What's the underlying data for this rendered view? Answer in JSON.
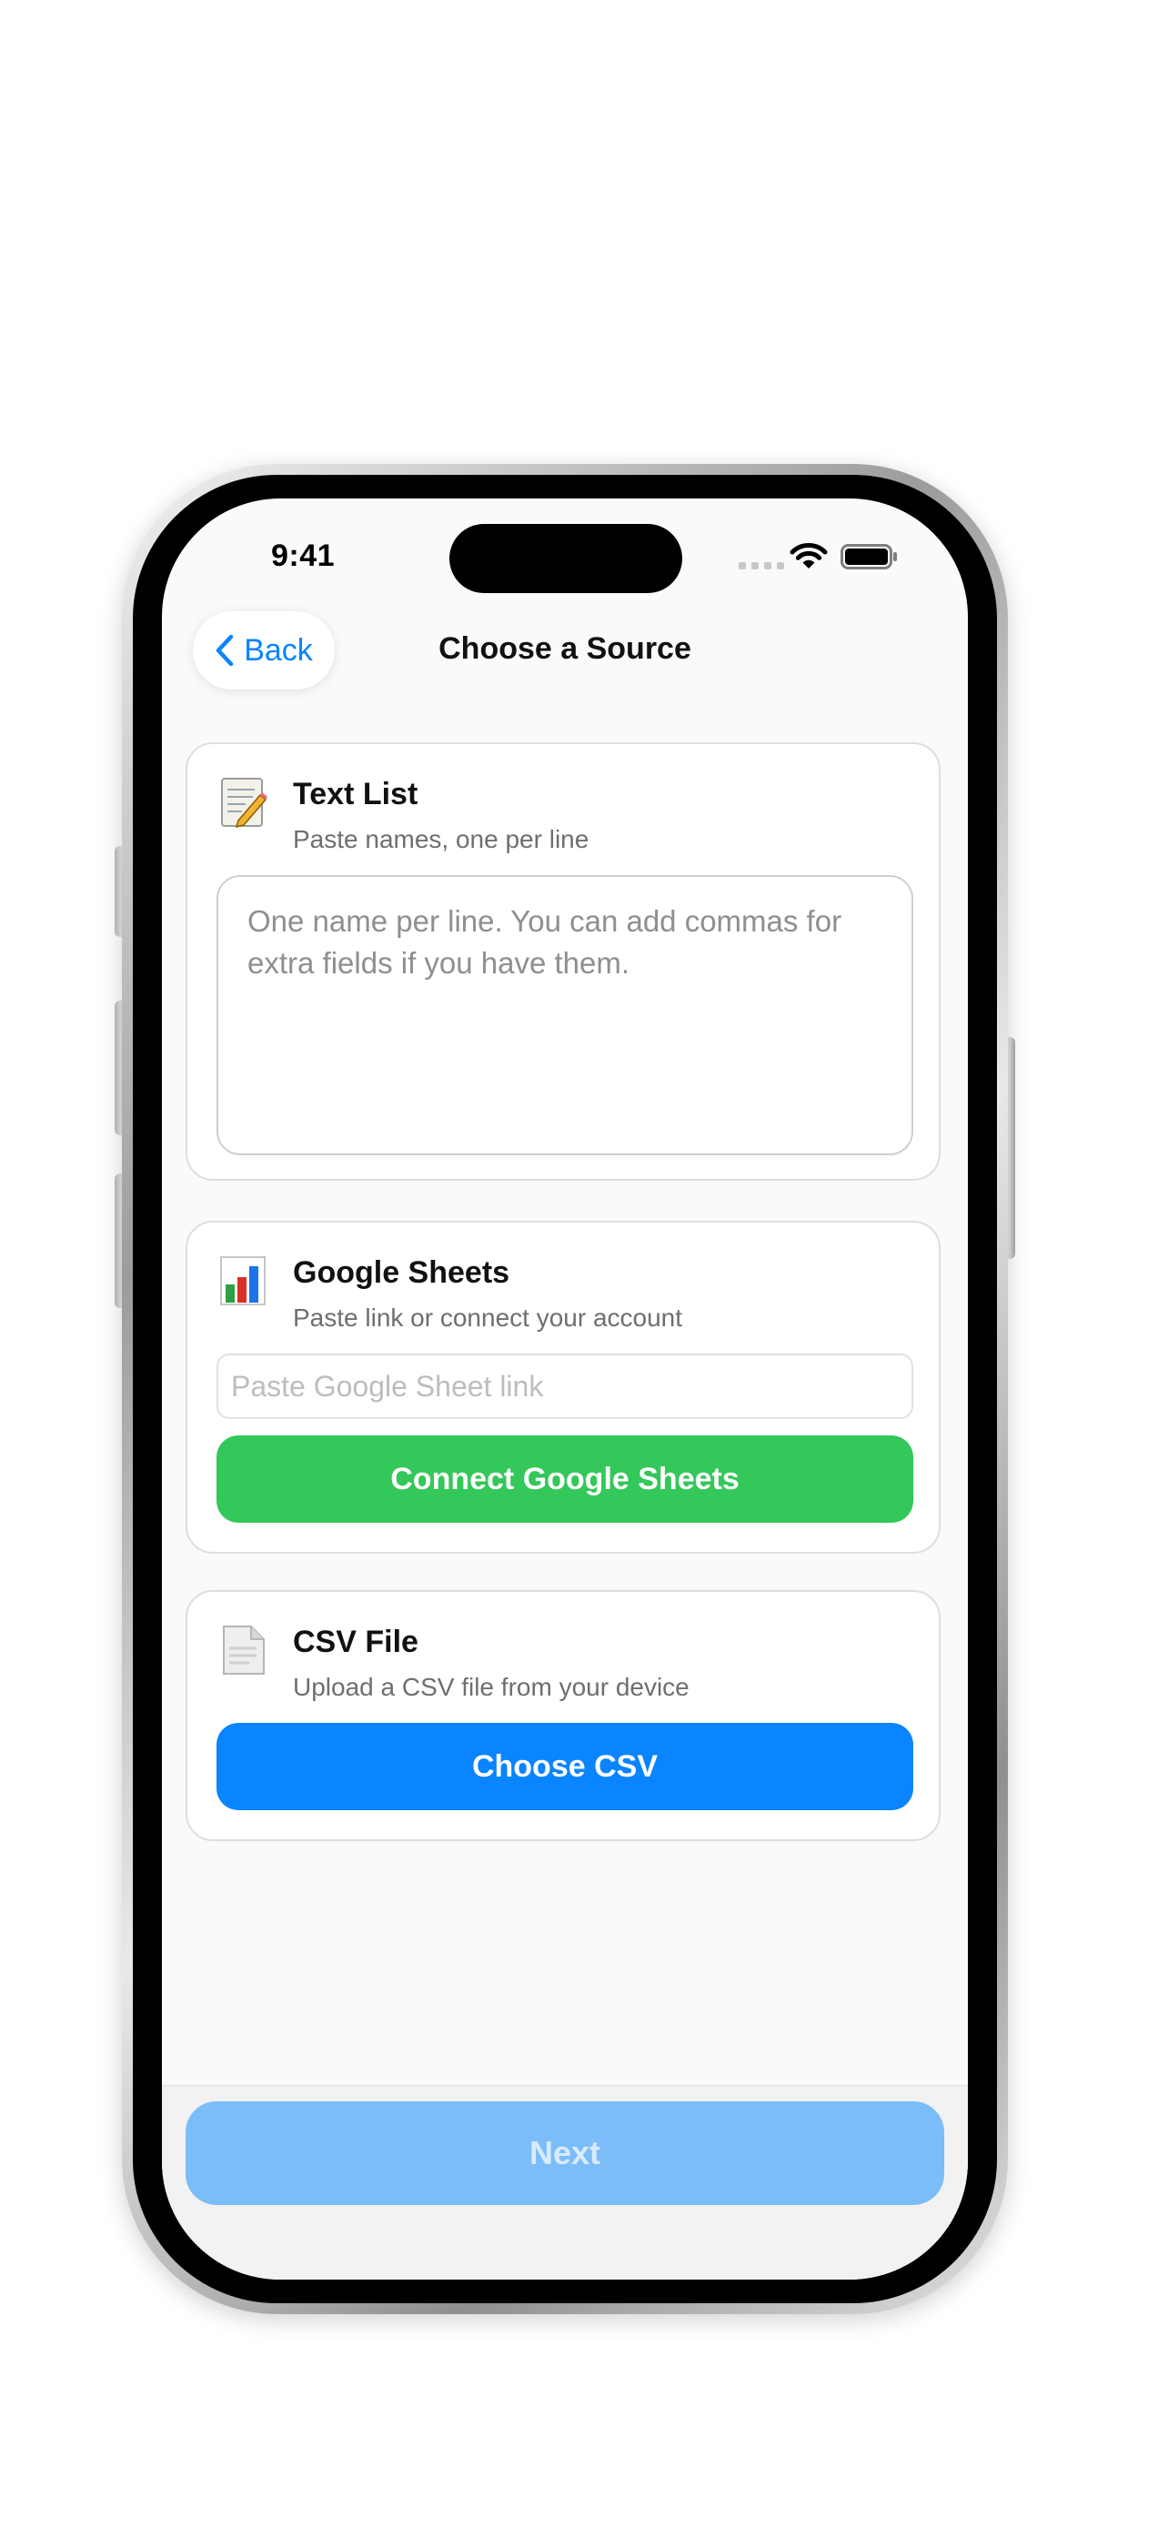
{
  "status_bar": {
    "time": "9:41"
  },
  "nav": {
    "back_label": "Back",
    "title": "Choose a Source"
  },
  "sources": {
    "text_list": {
      "icon": "notepad-icon",
      "title": "Text List",
      "subtitle": "Paste names, one per line",
      "textarea_placeholder": "One name per line. You can add commas for extra fields if you have them."
    },
    "google_sheets": {
      "icon": "bar-chart-icon",
      "title": "Google Sheets",
      "subtitle": "Paste link or connect your account",
      "link_placeholder": "Paste Google Sheet link",
      "connect_label": "Connect Google Sheets",
      "connect_color": "#34c759"
    },
    "csv_file": {
      "icon": "document-icon",
      "title": "CSV File",
      "subtitle": "Upload a CSV file from your device",
      "choose_label": "Choose CSV",
      "choose_color": "#0a84ff"
    }
  },
  "footer": {
    "next_label": "Next",
    "next_enabled": false
  }
}
